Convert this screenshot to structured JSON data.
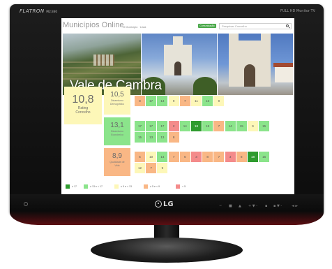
{
  "colors": {
    "very_high": "#2e9b2e",
    "high": "#8be48b",
    "medium": "#fdf7b8",
    "low": "#f9b785",
    "very_low": "#f48b8b"
  },
  "monitor": {
    "brand": "FLATRON",
    "brand_model": "M2380",
    "brand_right": "FULL HD  Monitor TV",
    "logo_text": "LG",
    "controls": [
      "~",
      "■",
      "▲",
      "+ ▼ -",
      "▪",
      "▪ ▼ -",
      "◄ ►"
    ],
    "power_icon": "power-icon"
  },
  "app": {
    "title": "Municípios Online",
    "subtitle": "O Município · Lista",
    "action_button": "Comunicação",
    "search_placeholder": "Pesquisar Concelho",
    "search_icon": "search-icon"
  },
  "banner": {
    "title": "Vale de Cambra"
  },
  "rating": {
    "value": "10,8",
    "label_line1": "Rating",
    "label_line2": "Concelho"
  },
  "categories": [
    {
      "value": "10,5",
      "label_line1": "Dinamismo",
      "label_line2": "Demográfico",
      "level": "medium",
      "cells": [
        {
          "v": "8",
          "l": "low"
        },
        {
          "v": "17",
          "l": "high"
        },
        {
          "v": "14",
          "l": "high"
        },
        {
          "v": "9",
          "l": "medium"
        },
        {
          "v": "7",
          "l": "low"
        },
        {
          "v": "11",
          "l": "medium"
        },
        {
          "v": "13",
          "l": "high"
        },
        {
          "v": "9",
          "l": "medium"
        }
      ]
    },
    {
      "value": "13,1",
      "label_line1": "Dinamismo",
      "label_line2": "Económico",
      "level": "high",
      "cells": [
        {
          "v": "17",
          "l": "high"
        },
        {
          "v": "17",
          "l": "high"
        },
        {
          "v": "17",
          "l": "high"
        },
        {
          "v": "2",
          "l": "very_low"
        },
        {
          "v": "14",
          "l": "high"
        },
        {
          "v": "18",
          "l": "very_high"
        },
        {
          "v": "15",
          "l": "high"
        },
        {
          "v": "7",
          "l": "low"
        },
        {
          "v": "14",
          "l": "high"
        },
        {
          "v": "15",
          "l": "high"
        },
        {
          "v": "9",
          "l": "medium"
        },
        {
          "v": "15",
          "l": "high"
        },
        {
          "v": "15",
          "l": "high"
        },
        {
          "v": "13",
          "l": "high"
        },
        {
          "v": "13",
          "l": "high"
        },
        {
          "v": "8",
          "l": "low"
        }
      ]
    },
    {
      "value": "8,9",
      "label_line1": "Qualidade de",
      "label_line2": "Vida",
      "level": "low",
      "cells": [
        {
          "v": "5",
          "l": "low"
        },
        {
          "v": "10",
          "l": "medium"
        },
        {
          "v": "14",
          "l": "high"
        },
        {
          "v": "7",
          "l": "low"
        },
        {
          "v": "6",
          "l": "low"
        },
        {
          "v": "3",
          "l": "very_low"
        },
        {
          "v": "8",
          "l": "low"
        },
        {
          "v": "7",
          "l": "low"
        },
        {
          "v": "3",
          "l": "very_low"
        },
        {
          "v": "8",
          "l": "low"
        },
        {
          "v": "18",
          "l": "very_high"
        },
        {
          "v": "16",
          "l": "high"
        },
        {
          "v": "12",
          "l": "medium"
        },
        {
          "v": "7",
          "l": "low"
        },
        {
          "v": "9",
          "l": "medium"
        }
      ]
    }
  ],
  "legend": [
    {
      "label": "≥ 17",
      "level": "very_high"
    },
    {
      "label": "≥ 13 e < 17",
      "level": "high"
    },
    {
      "label": "≥ 9 e < 13",
      "level": "medium"
    },
    {
      "label": "≥ 5 e < 9",
      "level": "low"
    },
    {
      "label": "< 5",
      "level": "very_low"
    }
  ]
}
